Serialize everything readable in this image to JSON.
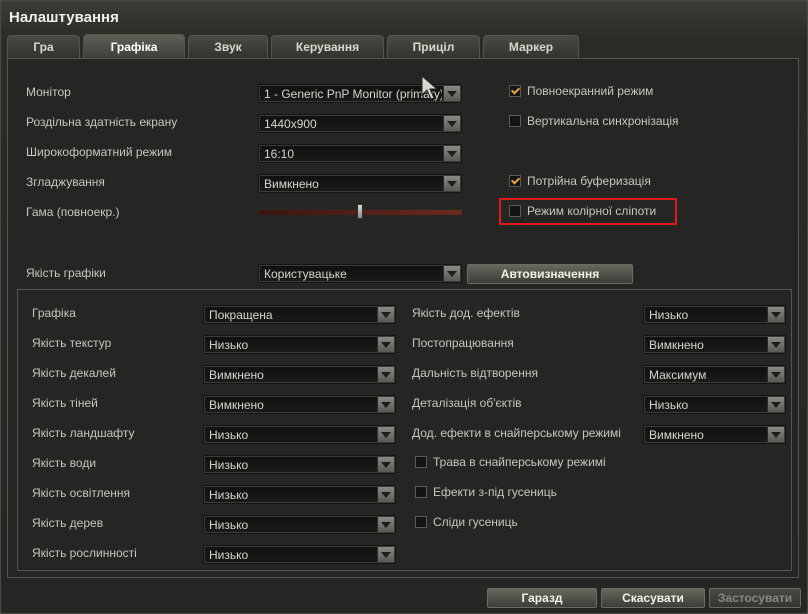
{
  "window": {
    "title": "Налаштування"
  },
  "tabs": [
    "Гра",
    "Графіка",
    "Звук",
    "Керування",
    "Приціл",
    "Маркер"
  ],
  "active_tab": "Графіка",
  "screen": {
    "monitor": {
      "label": "Монітор",
      "value": "1 - Generic PnP Monitor (primary)"
    },
    "resolution": {
      "label": "Роздільна здатність екрану",
      "value": "1440x900"
    },
    "widescreen": {
      "label": "Широкоформатний режим",
      "value": "16:10"
    },
    "antialiasing": {
      "label": "Згладжування",
      "value": "Вимкнено"
    },
    "gamma": {
      "label": "Гама (повноекр.)",
      "level_percent": 50
    }
  },
  "checkboxes": {
    "fullscreen": {
      "label": "Повноекранний режим",
      "checked": true
    },
    "vsync": {
      "label": "Вертикальна синхронізація",
      "checked": false
    },
    "triple_buffering": {
      "label": "Потрійна буферизація",
      "checked": true
    },
    "colorblind": {
      "label": "Режим колірної сліпоти",
      "checked": false
    }
  },
  "quality": {
    "label": "Якість графіки",
    "value": "Користувацьке",
    "auto_button": "Автовизначення"
  },
  "advanced_left": [
    {
      "label": "Графіка",
      "value": "Покращена"
    },
    {
      "label": "Якість текстур",
      "value": "Низько"
    },
    {
      "label": "Якість декалей",
      "value": "Вимкнено"
    },
    {
      "label": "Якість тіней",
      "value": "Вимкнено"
    },
    {
      "label": "Якість ландшафту",
      "value": "Низько"
    },
    {
      "label": "Якість води",
      "value": "Низько"
    },
    {
      "label": "Якість освітлення",
      "value": "Низько"
    },
    {
      "label": "Якість дерев",
      "value": "Низько"
    },
    {
      "label": "Якість рослинності",
      "value": "Низько"
    }
  ],
  "advanced_right": [
    {
      "label": "Якість дод. ефектів",
      "value": "Низько"
    },
    {
      "label": "Постопрацювання",
      "value": "Вимкнено"
    },
    {
      "label": "Дальність відтворення",
      "value": "Максимум"
    },
    {
      "label": "Деталізація об'єктів",
      "value": "Низько"
    },
    {
      "label": "Дод. ефекти в снайперському режимі",
      "value": "Вимкнено"
    }
  ],
  "advanced_checkboxes": [
    {
      "label": "Трава в снайперському режимі",
      "checked": false
    },
    {
      "label": "Ефекти з-під гусениць",
      "checked": false
    },
    {
      "label": "Сліди гусениць",
      "checked": false
    }
  ],
  "footer": {
    "ok": "Гаразд",
    "cancel": "Скасувати",
    "apply": "Застосувати"
  },
  "colors": {
    "accent": "#e8a040",
    "highlight": "#e0191b"
  }
}
